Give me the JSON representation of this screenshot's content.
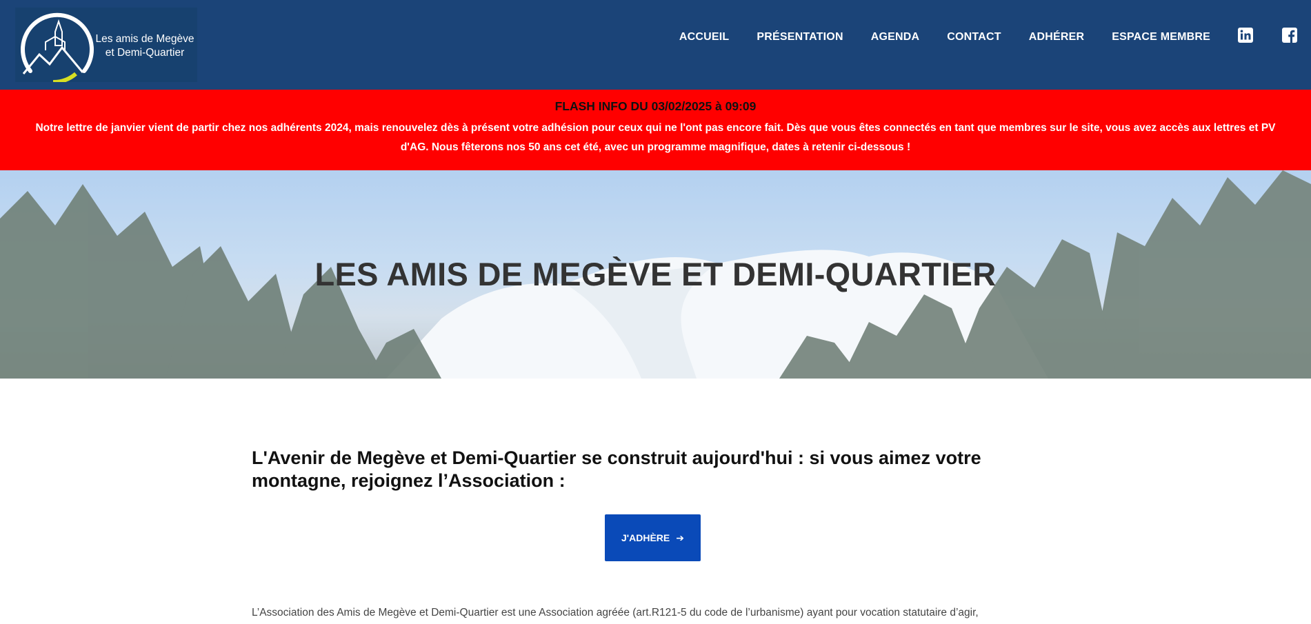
{
  "header": {
    "logo_line1": "Les amis de Megève",
    "logo_line2": "et Demi-Quartier",
    "nav": [
      {
        "label": "ACCUEIL"
      },
      {
        "label": "PRÉSENTATION"
      },
      {
        "label": "AGENDA"
      },
      {
        "label": "CONTACT"
      },
      {
        "label": "ADHÉRER"
      },
      {
        "label": "ESPACE MEMBRE"
      }
    ],
    "social": [
      "linkedin-icon",
      "facebook-icon"
    ],
    "colors": {
      "background": "#1b4478",
      "logo_accent": "#d7df23"
    }
  },
  "flash": {
    "title": "FLASH INFO DU 03/02/2025 à 09:09",
    "body": "Notre lettre de janvier vient de partir chez nos adhérents 2024, mais renouvelez dès à présent votre adhésion pour ceux qui ne l'ont pas encore fait. Dès que vous êtes connectés en tant que membres sur le site, vous avez accès aux lettres et PV d'AG. Nous fêterons nos 50 ans cet été, avec un programme magnifique, dates à retenir ci-dessous !",
    "color": "#ff0000"
  },
  "hero": {
    "title": "LES AMIS DE MEGÈVE ET DEMI-QUARTIER"
  },
  "main": {
    "heading": "L'Avenir de Megève et Demi-Quartier se construit aujourd'hui : si vous aimez votre montagne, rejoignez l’Association :",
    "cta_label": "J'ADHÈRE",
    "cta_icon": "arrow-right-icon",
    "cta_color": "#0a4ab8",
    "intro": "L’Association des Amis de Megève et Demi-Quartier est une Association agréée (art.R121-5 du code de l’urbanisme) ayant pour vocation statutaire d’agir,"
  }
}
